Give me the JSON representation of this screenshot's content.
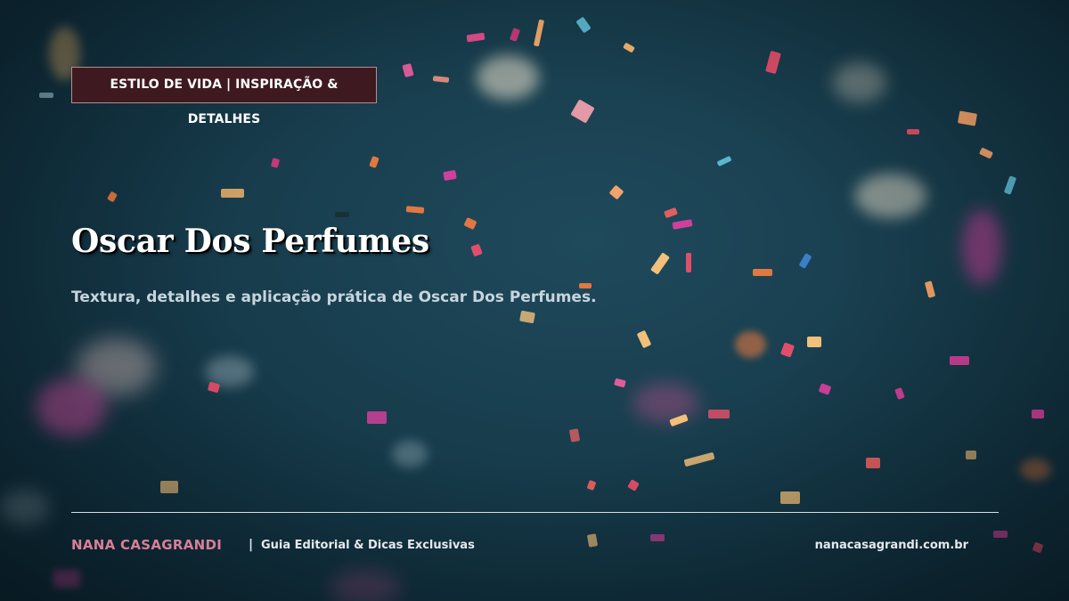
{
  "header": {
    "category_tag": "ESTILO DE VIDA | INSPIRAÇÃO & DETALHES"
  },
  "main": {
    "title": "Oscar Dos Perfumes",
    "subtitle": "Textura, detalhes e aplicação prática de Oscar Dos Perfumes."
  },
  "footer": {
    "brand": "NANA CASAGRANDI",
    "separator": "|",
    "tagline": "Guia Editorial & Dicas Exclusivas",
    "website": "nanacasagrandi.com.br"
  },
  "colors": {
    "background": "#173c4c",
    "tag_background": "#3e1a20",
    "tag_border": "#b58c91",
    "brand_accent": "#d97f96",
    "text_primary": "#ffffff",
    "text_secondary": "#c7d4dd"
  }
}
